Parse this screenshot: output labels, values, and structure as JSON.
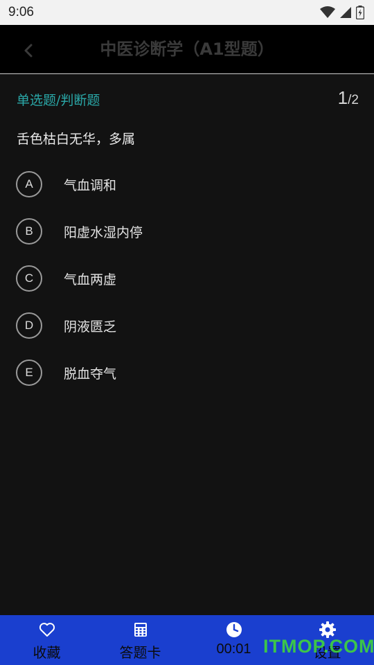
{
  "status_bar": {
    "time": "9:06"
  },
  "header": {
    "title": "中医诊断学（A1型题）"
  },
  "question": {
    "type_label": "单选题/判断题",
    "current": "1",
    "separator": "/",
    "total": "2",
    "stem": "舌色枯白无华，多属",
    "options": [
      {
        "letter": "A",
        "text": "气血调和"
      },
      {
        "letter": "B",
        "text": "阳虚水湿内停"
      },
      {
        "letter": "C",
        "text": "气血两虚"
      },
      {
        "letter": "D",
        "text": "阴液匮乏"
      },
      {
        "letter": "E",
        "text": "脱血夺气"
      }
    ]
  },
  "bottom_bar": {
    "tabs": [
      {
        "label": "收藏",
        "icon": "heart-icon"
      },
      {
        "label": "答题卡",
        "icon": "grid-icon"
      },
      {
        "label": "00:01",
        "icon": "clock-icon"
      },
      {
        "label": "设置",
        "icon": "gear-icon"
      }
    ]
  },
  "watermark": "ITMOP.COM",
  "colors": {
    "bottom_bar": "#1a3fcf",
    "accent": "#2aa8a8",
    "background": "#121212"
  }
}
